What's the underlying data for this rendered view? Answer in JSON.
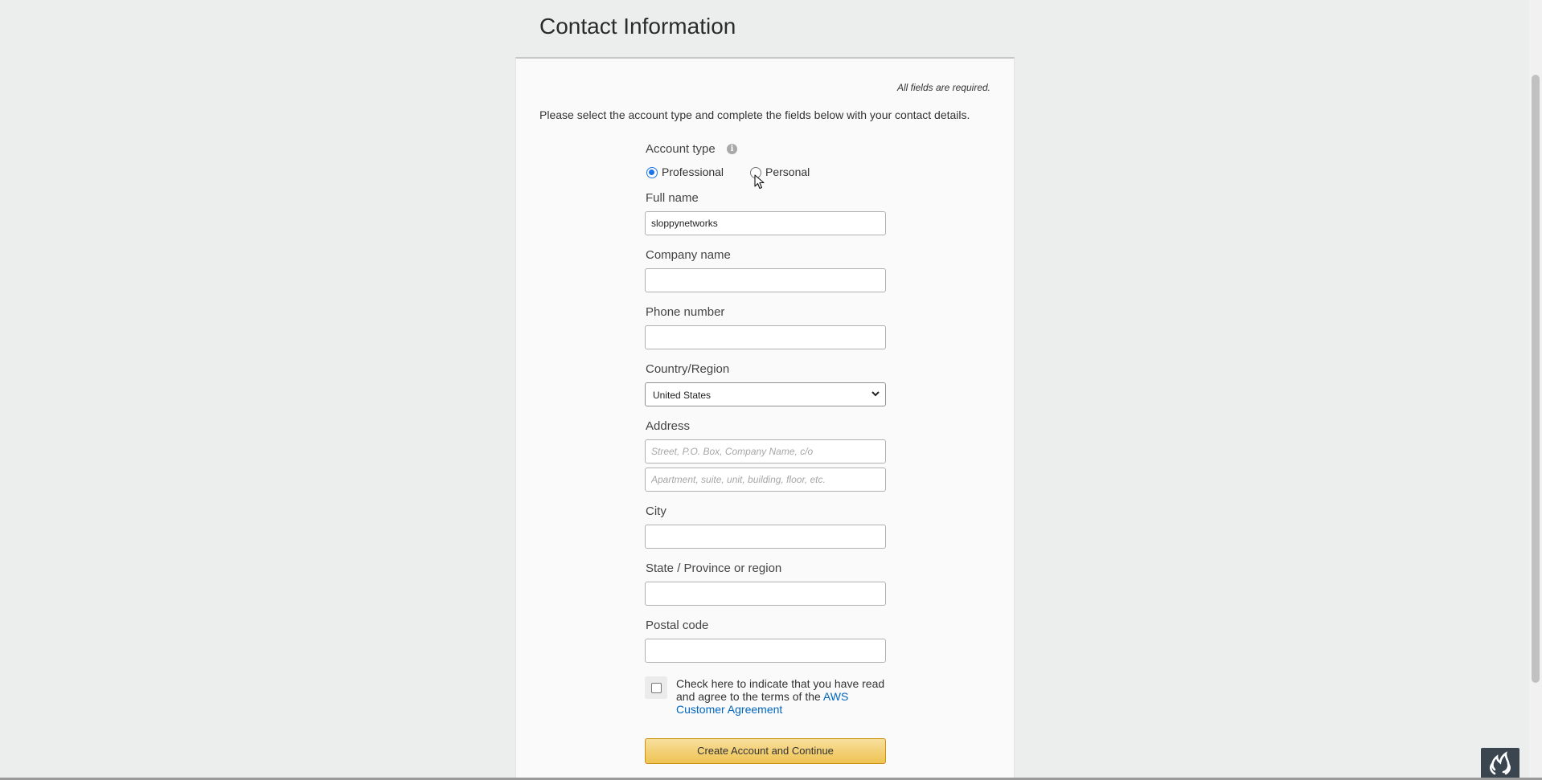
{
  "page": {
    "title": "Contact Information",
    "required_note": "All fields are required.",
    "intro": "Please select the account type and complete the fields below with your contact details."
  },
  "form": {
    "account_type": {
      "label": "Account type",
      "info_icon": "info-icon",
      "options": [
        {
          "label": "Professional",
          "selected": true
        },
        {
          "label": "Personal",
          "selected": false
        }
      ]
    },
    "full_name": {
      "label": "Full name",
      "value": "sloppynetworks"
    },
    "company_name": {
      "label": "Company name",
      "value": ""
    },
    "phone_number": {
      "label": "Phone number",
      "value": ""
    },
    "country": {
      "label": "Country/Region",
      "selected": "United States"
    },
    "address": {
      "label": "Address",
      "line1_placeholder": "Street, P.O. Box, Company Name, c/o",
      "line2_placeholder": "Apartment, suite, unit, building, floor, etc."
    },
    "city": {
      "label": "City",
      "value": ""
    },
    "state": {
      "label": "State / Province or region",
      "value": ""
    },
    "postal_code": {
      "label": "Postal code",
      "value": ""
    },
    "agreement": {
      "checked": false,
      "text": "Check here to indicate that you have read and agree to the terms of the",
      "link_text": "AWS Customer Agreement"
    },
    "submit_label": "Create Account and Continue"
  },
  "colors": {
    "page_background": "#eceded",
    "card_background": "#fafafa",
    "link": "#0066c0",
    "radio_accent": "#1a73e8",
    "button_top": "#f8df9d",
    "button_bottom": "#efc352"
  }
}
